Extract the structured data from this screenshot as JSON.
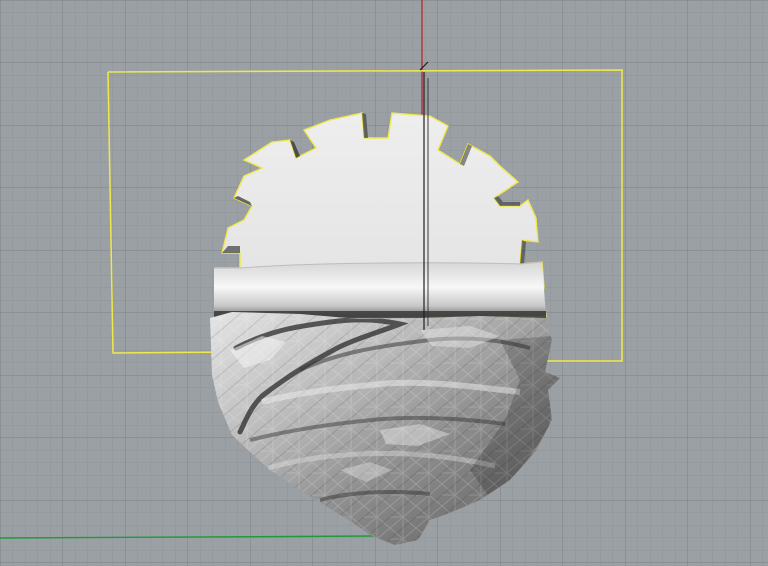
{
  "viewport": {
    "background": "#9aa0a4",
    "grid_minor_color": "#8e9498",
    "grid_major_color": "#7c8287",
    "world_x_axis_color": "#1f9a3a",
    "world_y_axis_color": "#b51f24",
    "selection_color": "#f0e84a"
  },
  "objects": {
    "selected_curve": "selected-outline-curve",
    "gear_surface": "notched-disc-surface",
    "lower_mesh": "rock-mesh",
    "vertical_line": "vertical-line-curve"
  }
}
